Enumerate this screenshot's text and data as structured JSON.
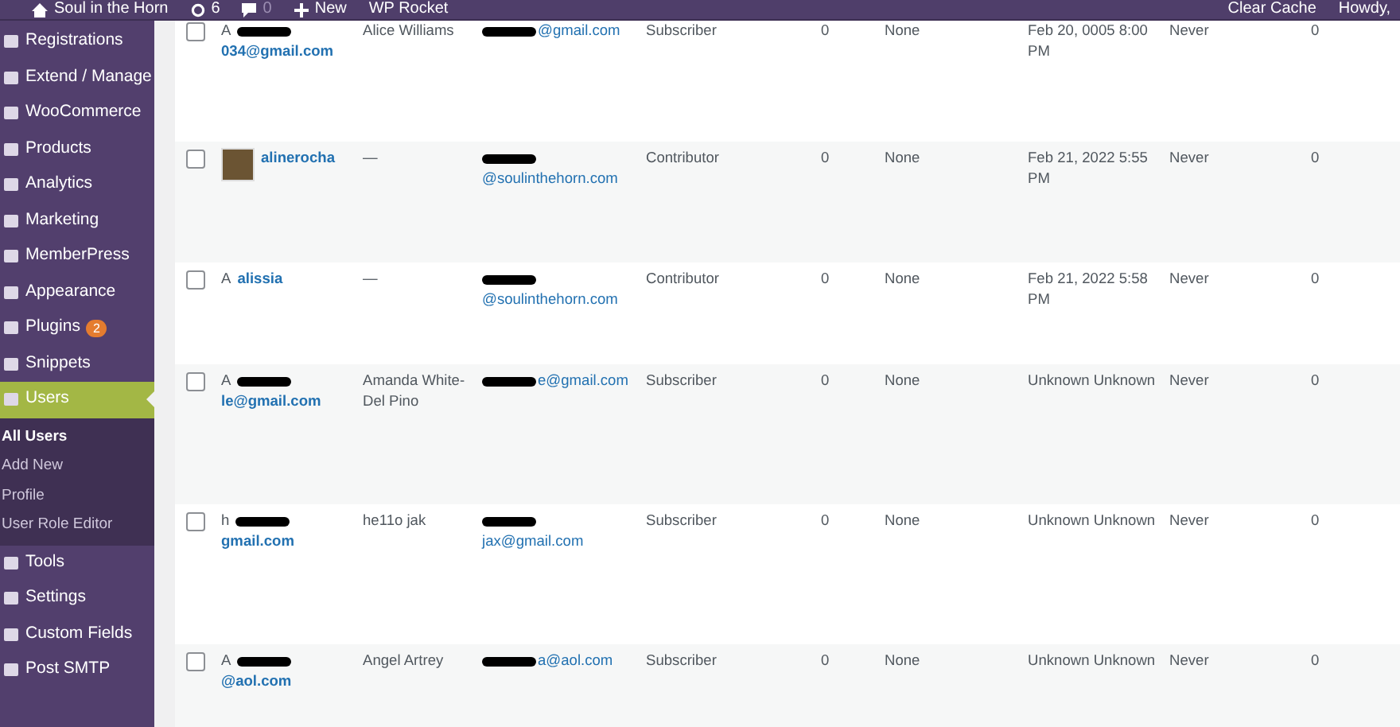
{
  "admin_bar": {
    "site": "Soul in the Horn",
    "updates": "6",
    "comments": "0",
    "new": "New",
    "plugin": "WP Rocket",
    "clear_cache": "Clear Cache",
    "greeting": "Howdy,"
  },
  "sidebar": {
    "items": [
      {
        "label": "Registrations",
        "current": false
      },
      {
        "label": "Extend / Manage",
        "current": false
      },
      {
        "label": "WooCommerce",
        "current": false
      },
      {
        "label": "Products",
        "current": false
      },
      {
        "label": "Analytics",
        "current": false
      },
      {
        "label": "Marketing",
        "current": false
      },
      {
        "label": "MemberPress",
        "current": false
      },
      {
        "label": "Appearance",
        "current": false
      },
      {
        "label": "Plugins",
        "current": false,
        "badge": "2"
      },
      {
        "label": "Snippets",
        "current": false
      },
      {
        "label": "Users",
        "current": true,
        "children": [
          {
            "label": "All Users",
            "selected": true
          },
          {
            "label": "Add New",
            "selected": false
          },
          {
            "label": "Profile",
            "selected": false
          },
          {
            "label": "User Role Editor",
            "selected": false
          }
        ]
      },
      {
        "label": "Tools",
        "current": false
      },
      {
        "label": "Settings",
        "current": false
      },
      {
        "label": "Custom Fields",
        "current": false
      },
      {
        "label": "Post SMTP",
        "current": false
      }
    ]
  },
  "table": {
    "rows": [
      {
        "checked": false,
        "avatar": {
          "kind": "alt",
          "text": "A"
        },
        "login": "034@gmail.com",
        "login_redacted": true,
        "name": "Alice Williams",
        "email": "@gmail.com",
        "email_redacted": true,
        "role": "Subscriber",
        "column_6": "0",
        "column_7": "None",
        "registered": "Feb 20, 0005 8:00 PM",
        "column_9": "Never",
        "column_10": "0"
      },
      {
        "checked": false,
        "avatar": {
          "kind": "photo"
        },
        "login": "alinerocha",
        "login_redacted": false,
        "name": "—",
        "email": "@soulinthehorn.com",
        "email_redacted": true,
        "role": "Contributor",
        "column_6": "0",
        "column_7": "None",
        "registered": "Feb 21, 2022 5:55 PM",
        "column_9": "Never",
        "column_10": "0"
      },
      {
        "checked": false,
        "avatar": {
          "kind": "alt",
          "text": "A"
        },
        "login": "alissia",
        "login_redacted": false,
        "name": "—",
        "email": "@soulinthehorn.com",
        "email_redacted": true,
        "role": "Contributor",
        "column_6": "0",
        "column_7": "None",
        "registered": "Feb 21, 2022 5:58 PM",
        "column_9": "Never",
        "column_10": "0"
      },
      {
        "checked": false,
        "avatar": {
          "kind": "alt",
          "text": "A"
        },
        "login": "le@gmail.com",
        "login_redacted": true,
        "name": "Amanda White-Del Pino",
        "email": "e@gmail.com",
        "email_redacted": true,
        "role": "Subscriber",
        "column_6": "0",
        "column_7": "None",
        "registered": "Unknown Unknown",
        "column_9": "Never",
        "column_10": "0"
      },
      {
        "checked": false,
        "avatar": {
          "kind": "alt",
          "text": "h"
        },
        "login": "gmail.com",
        "login_redacted": true,
        "name": "he11o jak",
        "email": "jax@gmail.com",
        "email_redacted": true,
        "role": "Subscriber",
        "column_6": "0",
        "column_7": "None",
        "registered": "Unknown Unknown",
        "column_9": "Never",
        "column_10": "0"
      },
      {
        "checked": false,
        "avatar": {
          "kind": "alt",
          "text": "A"
        },
        "login": "@aol.com",
        "login_redacted": true,
        "name": "Angel Artrey",
        "email": "a@aol.com",
        "email_redacted": true,
        "role": "Subscriber",
        "column_6": "0",
        "column_7": "None",
        "registered": "Unknown Unknown",
        "column_9": "Never",
        "column_10": "0"
      }
    ]
  }
}
